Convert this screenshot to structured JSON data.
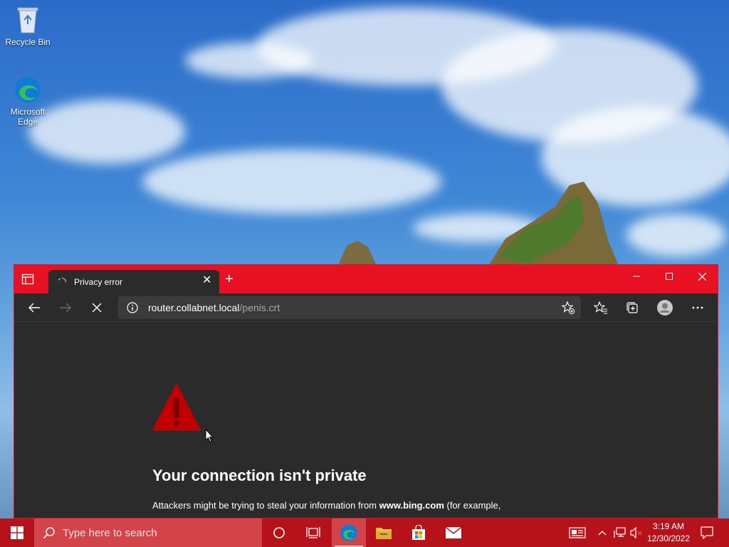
{
  "desktop": {
    "icons": [
      {
        "label": "Recycle Bin",
        "icon": "recycle-bin-icon"
      },
      {
        "label": "Microsoft Edge",
        "icon": "edge-icon"
      }
    ]
  },
  "browser": {
    "accent": "#e81123",
    "tab": {
      "title": "Privacy error",
      "loading": true
    },
    "address": {
      "host": "router.collabnet.local",
      "path": "/penis.crt"
    },
    "page": {
      "title": "Your connection isn't private",
      "body_prefix": "Attackers might be trying to steal your information from ",
      "body_site": "www.bing.com",
      "body_suffix": " (for example,"
    }
  },
  "taskbar": {
    "color": "#b5121b",
    "search_placeholder": "Type here to search",
    "time": "3:19 AM",
    "date": "12/30/2022",
    "pinned": [
      "cortana-icon",
      "task-view-icon",
      "edge-icon",
      "file-explorer-icon",
      "microsoft-store-icon",
      "mail-icon"
    ]
  }
}
